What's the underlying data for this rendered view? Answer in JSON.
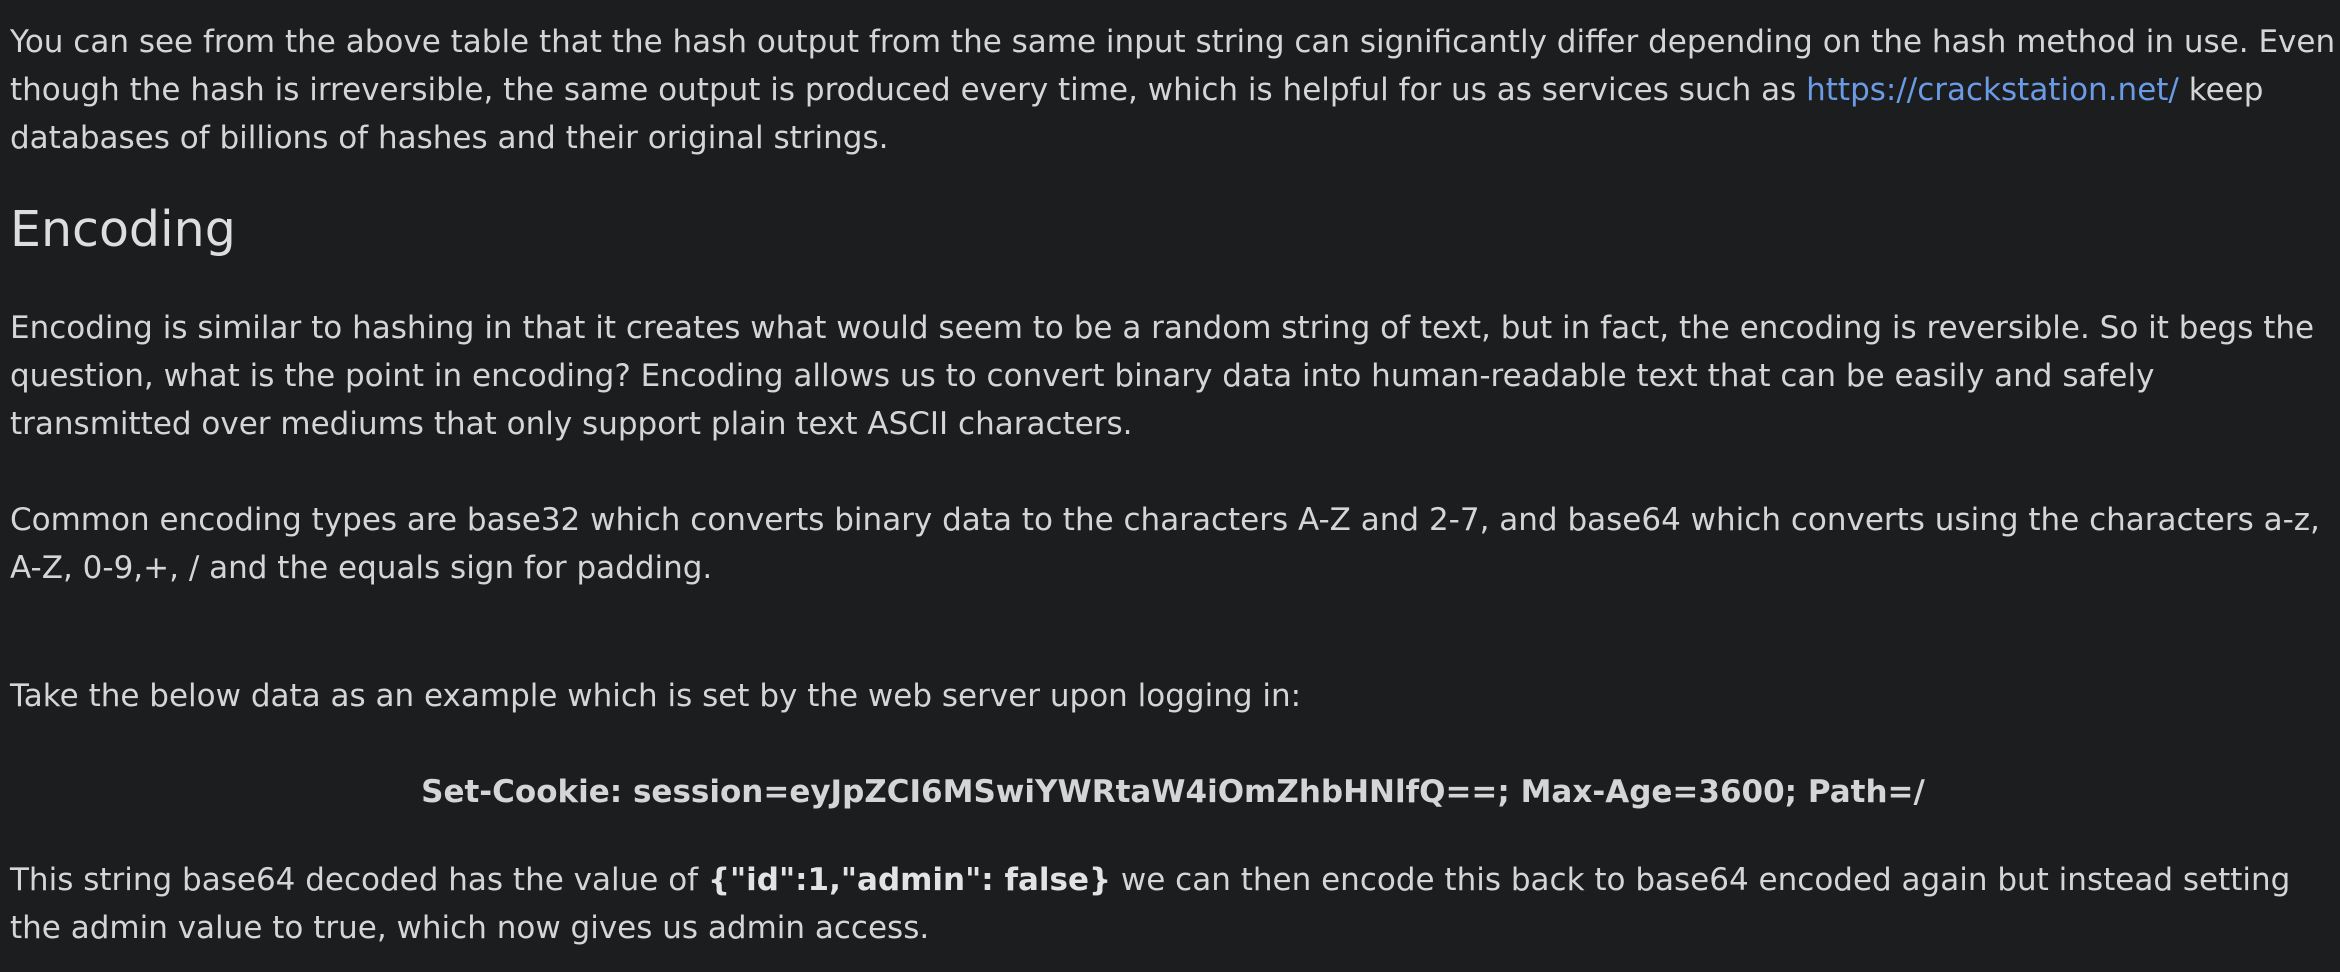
{
  "article": {
    "p1": {
      "before": "You can see from the above table that the hash output from the same input string can significantly differ depending on the hash method in use. Even though the hash is irreversible, the same output is produced every time, which is helpful for us as services such as ",
      "link_text": "https://crackstation.net/",
      "after": " keep databases of billions of hashes and their original strings."
    },
    "heading": "Encoding",
    "p2": "Encoding is similar to hashing in that it creates what would seem to be a random string of text, but in fact, the encoding is reversible. So it begs the question, what is the point in encoding? Encoding allows us to convert binary data into human-readable text that can be easily and safely transmitted over mediums that only support plain text ASCII characters.",
    "p3": "Common encoding types are base32 which converts binary data to the characters A-Z and 2-7, and base64 which converts using the characters a-z, A-Z, 0-9,+, / and the equals sign for padding.",
    "p4": "Take the below data as an example which is set by the web server upon logging in:",
    "cookie": "Set-Cookie: session=eyJpZCI6MSwiYWRtaW4iOmZhbHNlfQ==; Max-Age=3600; Path=/",
    "p5": {
      "before": "This string base64 decoded has the value of ",
      "bold": "{\"id\":1,\"admin\": false}",
      "after": " we can then encode this back to base64 encoded again but instead setting the admin value to true, which now gives us admin access."
    }
  },
  "colors": {
    "background": "#1c1d1f",
    "text": "#d4d5d6",
    "link": "#6b9ae6"
  }
}
